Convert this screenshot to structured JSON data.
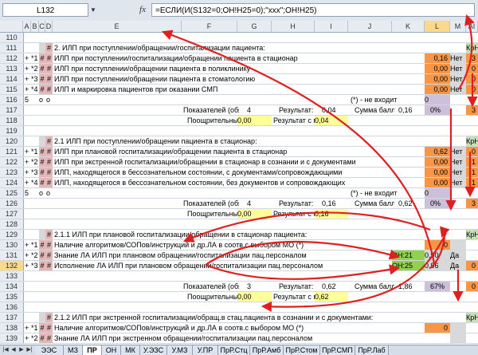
{
  "formula_bar": {
    "name_box": "L132",
    "fx": "fx",
    "formula": "=ЕСЛИ(И(S132=0;ОН!H25=0);\"ххх\";ОН!H25)"
  },
  "columns": [
    "",
    "A",
    "B",
    "C",
    "D",
    "E",
    "F",
    "G",
    "H",
    "I",
    "J",
    "K",
    "L",
    "M",
    "AI"
  ],
  "rows": [
    {
      "num": "110",
      "type": "blank"
    },
    {
      "num": "111",
      "type": "section",
      "d": "#",
      "text": "2.  ИЛП при поступлении/обращении/госпитализации пациента:",
      "ai": "КрН"
    },
    {
      "num": "112",
      "flag": "+",
      "a": "*1",
      "hash": "#",
      "text": "ИЛП при поступлении/госпитализации/обращении пациента в стационар",
      "l": "0,16",
      "m": "Нет",
      "ai": "3"
    },
    {
      "num": "113",
      "flag": "+",
      "a": "*2",
      "hash": "#",
      "text": "ИЛП при поступлении/обращении пациента в поликлинику",
      "l": "0,00",
      "m": "Нет",
      "ai": "0"
    },
    {
      "num": "114",
      "flag": "+",
      "a": "*3",
      "hash": "#",
      "text": "ИЛП при поступлении/обращении пациента в стоматологию",
      "l": "0,00",
      "m": "Нет",
      "ai": "0"
    },
    {
      "num": "115",
      "flag": "+",
      "a": "*4",
      "hash": "#",
      "text": "ИЛП и маркировка пациентов при оказании СМП",
      "l": "0,00",
      "m": "Нет",
      "ai": "0"
    },
    {
      "num": "116",
      "flag": "5",
      "c": "o",
      "d": "o",
      "type": "note",
      "note": "(*) - не входит",
      "l": "0"
    },
    {
      "num": "117",
      "type": "summary",
      "f": "Показателей (обязат.тр.):",
      "g": "4",
      "h": "Результат:",
      "i": "0,04",
      "k": "Сумма баллов:",
      "l": "0,16",
      "m": "0%",
      "ai": "3"
    },
    {
      "num": "118",
      "type": "bonus",
      "f": "Поощрительный балл:",
      "g": "0,00",
      "h": "Результат с поощр.б.:",
      "i": "0,04"
    },
    {
      "num": "119",
      "type": "blank"
    },
    {
      "num": "120",
      "type": "section",
      "d": "#",
      "text": "2.1  ИЛП при поступлении/обращении пациента в стационар:",
      "ai": "КрНс"
    },
    {
      "num": "121",
      "flag": "+",
      "a": "*1",
      "hash": "#",
      "text": "ИЛП при плановой госпитализации/обращении пациента в стационар",
      "l": "0,62",
      "m": "Нет",
      "ai": "0"
    },
    {
      "num": "122",
      "flag": "+",
      "a": "*2",
      "hash": "#",
      "text": "ИЛП при экстренной госпитализации/обращении в стационар в сознании и с документами",
      "l": "0,00",
      "m": "Нет",
      "ai": "1"
    },
    {
      "num": "123",
      "flag": "+",
      "a": "*3",
      "hash": "#",
      "text": "ИЛП, находящегося в бессознательном состоянии, с документами/сопровождающими",
      "l": "0,00",
      "m": "Нет",
      "ai": "1"
    },
    {
      "num": "124",
      "flag": "+",
      "a": "*4",
      "hash": "#",
      "text": "ИЛП, находящегося в бессознательном состоянии, без документов и сопровождающих",
      "l": "0,00",
      "m": "Нет",
      "ai": "1"
    },
    {
      "num": "125",
      "flag": "5",
      "c": "o",
      "d": "o",
      "type": "note",
      "note": "(*) - не входит",
      "l": "0"
    },
    {
      "num": "126",
      "type": "summary",
      "f": "Показателей (обязат.тр.):",
      "g": "4",
      "h": "Результат:",
      "i": "0,16",
      "k": "Сумма баллов:",
      "l": "0,62",
      "m": "0%",
      "ai": "3"
    },
    {
      "num": "127",
      "type": "bonus",
      "f": "Поощрительный балл:",
      "g": "0,00",
      "h": "Результат с поощр.б.:",
      "i": "0,16"
    },
    {
      "num": "128",
      "type": "blank"
    },
    {
      "num": "129",
      "type": "section",
      "d": "#",
      "text": "2.1.1  ИЛП при плановой госпитализации/обращении в стационар пациента:",
      "ai": "КрН"
    },
    {
      "num": "130",
      "flag": "+",
      "a": "*1",
      "hash": "#",
      "text": "Наличие алгоритмов/СОПов/инструкций и др.ЛА в соотв.с выбором МО (*)",
      "l": "0",
      "m": "",
      "ai": ""
    },
    {
      "num": "131",
      "flag": "+",
      "a": "*2",
      "hash": "#",
      "text": "Знание ЛА ИЛП при плановом обращении/госпитализации пац.персоналом",
      "k": "ОН:21",
      "l": "0,90",
      "m": "Да",
      "ai": ""
    },
    {
      "num": "132",
      "flag": "+",
      "a": "*3",
      "hash": "#",
      "text": "Исполнение ЛА ИЛП при плановом обращении/госпитализации пац.персоналом",
      "k": "ОН:25",
      "l": "0,96",
      "m": "Да",
      "ai": "0",
      "selected": true
    },
    {
      "num": "133",
      "type": "blank"
    },
    {
      "num": "134",
      "type": "summary",
      "f": "Показателей (обязат.тр.):",
      "g": "3",
      "h": "Результат:",
      "i": "0,62",
      "k": "Сумма баллов:",
      "l": "1,86",
      "m": "67%",
      "ai": "0"
    },
    {
      "num": "135",
      "type": "bonus",
      "f": "Поощрительный балл:",
      "g": "0,00",
      "h": "Результат с поощр.б.:",
      "i": "0,62"
    },
    {
      "num": "136",
      "type": "blank"
    },
    {
      "num": "137",
      "type": "section",
      "d": "#",
      "text": "2.1.2  ИЛП при экстренной госпитализации/обращ.в стац.пациента в сознании и с документами:",
      "ai": "КрН"
    },
    {
      "num": "138",
      "flag": "+",
      "a": "*1",
      "hash": "#",
      "text": "Наличие алгоритмов/СОПов/инструкций и др.ЛА в соотв.с выбором МО (*)",
      "l": "0",
      "m": "",
      "ai": ""
    },
    {
      "num": "139",
      "flag": "+",
      "a": "*2",
      "hash": "#",
      "text": "Знание ЛА ИЛП при экстренном обращении/госпитализации пац.персоналом",
      "l": "",
      "m": "",
      "ai": ""
    }
  ],
  "sheet_tabs": [
    "ЭЭС",
    "МЗ",
    "ПР",
    "ОН",
    "МК",
    "У.ЭЗС",
    "У.МЗ",
    "У.ПР",
    "ПрР.Стц",
    "ПрР.Амб",
    "ПрР.Стом",
    "ПрР.СМП",
    "ПрР.Лаб"
  ],
  "active_tab": "ПР",
  "accent_color": "#e02020"
}
